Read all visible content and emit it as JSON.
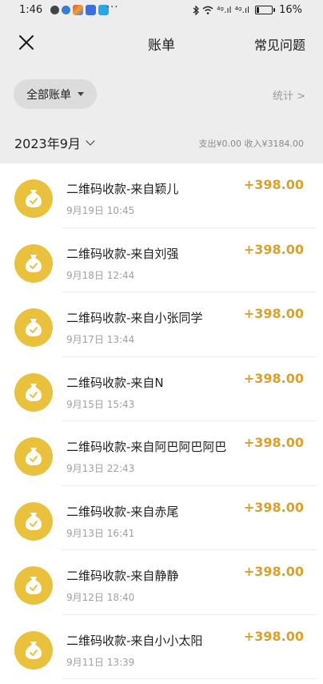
{
  "status_bar": {
    "time": "1:46",
    "dots": "···",
    "signal_1": "⁴ᵍ.ıl",
    "signal_2": "⁴ᵍ.ıl",
    "battery_percent": "16%",
    "battery_level": 0.16
  },
  "nav": {
    "title": "账单",
    "faq_label": "常见问题",
    "close_icon": "close-icon"
  },
  "filter": {
    "all_bills_label": "全部账单",
    "stats_label": "统计 >"
  },
  "month_header": {
    "month_label": "2023年9月",
    "summary": "支出¥0.00 收入¥3184.00"
  },
  "colors": {
    "accent_gold": "#e9c13d",
    "amount_gold": "#d9a12b",
    "header_bg": "#ededed"
  },
  "transactions": [
    {
      "title": "二维码收款-来自颖儿",
      "time": "9月19日 10:45",
      "amount": "+398.00"
    },
    {
      "title": "二维码收款-来自刘强",
      "time": "9月18日 12:44",
      "amount": "+398.00"
    },
    {
      "title": "二维码收款-来自小张同学",
      "time": "9月17日 13:44",
      "amount": "+398.00"
    },
    {
      "title": "二维码收款-来自N",
      "time": "9月15日 15:43",
      "amount": "+398.00"
    },
    {
      "title": "二维码收款-来自阿巴阿巴阿巴",
      "time": "9月13日 22:43",
      "amount": "+398.00"
    },
    {
      "title": "二维码收款-来自赤尾",
      "time": "9月13日 16:41",
      "amount": "+398.00"
    },
    {
      "title": "二维码收款-来自静静",
      "time": "9月12日 18:40",
      "amount": "+398.00"
    },
    {
      "title": "二维码收款-来自小小太阳",
      "time": "9月11日 13:39",
      "amount": "+398.00"
    }
  ]
}
